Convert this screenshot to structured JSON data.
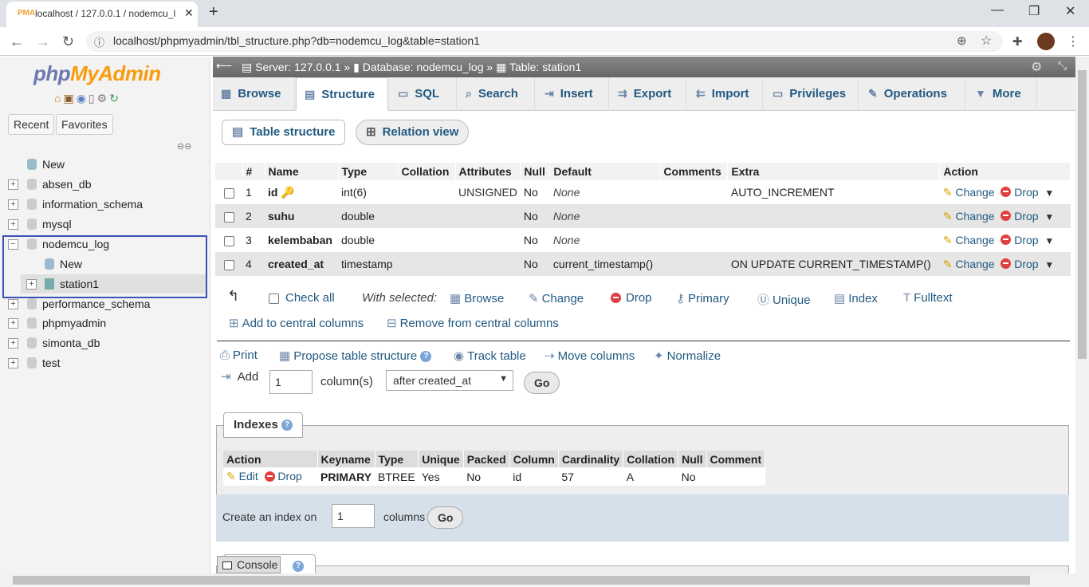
{
  "browser": {
    "tab_title": "localhost / 127.0.0.1 / nodemcu_l",
    "url": "localhost/phpmyadmin/tbl_structure.php?db=nodemcu_log&table=station1",
    "new_tab": "+"
  },
  "nav": {
    "logo_php": "php",
    "logo_myadmin": "MyAdmin",
    "recent": "Recent",
    "favorites": "Favorites",
    "tree": [
      {
        "label": "New"
      },
      {
        "label": "absen_db"
      },
      {
        "label": "information_schema"
      },
      {
        "label": "mysql"
      },
      {
        "label": "nodemcu_log"
      },
      {
        "label": "New"
      },
      {
        "label": "station1"
      },
      {
        "label": "performance_schema"
      },
      {
        "label": "phpmyadmin"
      },
      {
        "label": "simonta_db"
      },
      {
        "label": "test"
      }
    ]
  },
  "breadcrumb": {
    "server": "Server: 127.0.0.1",
    "database": "Database: nodemcu_log",
    "table": "Table: station1"
  },
  "tabs": [
    "Browse",
    "Structure",
    "SQL",
    "Search",
    "Insert",
    "Export",
    "Import",
    "Privileges",
    "Operations",
    "More"
  ],
  "subnav": [
    "Table structure",
    "Relation view"
  ],
  "structure": {
    "headers": [
      "#",
      "Name",
      "Type",
      "Collation",
      "Attributes",
      "Null",
      "Default",
      "Comments",
      "Extra",
      "Action"
    ],
    "rows": [
      {
        "num": "1",
        "name": "id",
        "type": "int(6)",
        "collation": "",
        "attributes": "UNSIGNED",
        "null": "No",
        "default": "None",
        "comments": "",
        "extra": "AUTO_INCREMENT"
      },
      {
        "num": "2",
        "name": "suhu",
        "type": "double",
        "collation": "",
        "attributes": "",
        "null": "No",
        "default": "None",
        "comments": "",
        "extra": ""
      },
      {
        "num": "3",
        "name": "kelembaban",
        "type": "double",
        "collation": "",
        "attributes": "",
        "null": "No",
        "default": "None",
        "comments": "",
        "extra": ""
      },
      {
        "num": "4",
        "name": "created_at",
        "type": "timestamp",
        "collation": "",
        "attributes": "",
        "null": "No",
        "default": "current_timestamp()",
        "comments": "",
        "extra": "ON UPDATE CURRENT_TIMESTAMP()"
      }
    ],
    "action_change": "Change",
    "action_drop": "Drop"
  },
  "with_selected": {
    "check_all": "Check all",
    "label": "With selected:",
    "browse": "Browse",
    "change": "Change",
    "drop": "Drop",
    "primary": "Primary",
    "unique": "Unique",
    "index": "Index",
    "fulltext": "Fulltext",
    "add_central": "Add to central columns",
    "remove_central": "Remove from central columns"
  },
  "tools": {
    "print": "Print",
    "propose": "Propose table structure",
    "track": "Track table",
    "move": "Move columns",
    "normalize": "Normalize"
  },
  "add_column": {
    "label": "Add",
    "value": "1",
    "columns_label": "column(s)",
    "position": "after created_at",
    "go": "Go"
  },
  "indexes": {
    "legend": "Indexes",
    "headers": [
      "Action",
      "Keyname",
      "Type",
      "Unique",
      "Packed",
      "Column",
      "Cardinality",
      "Collation",
      "Null",
      "Comment"
    ],
    "row": {
      "edit": "Edit",
      "drop": "Drop",
      "keyname": "PRIMARY",
      "type": "BTREE",
      "unique": "Yes",
      "packed": "No",
      "column": "id",
      "cardinality": "57",
      "collation": "A",
      "null": "No",
      "comment": ""
    },
    "create_label": "Create an index on",
    "create_value": "1",
    "columns_label": "columns",
    "go": "Go"
  },
  "console": "Console"
}
